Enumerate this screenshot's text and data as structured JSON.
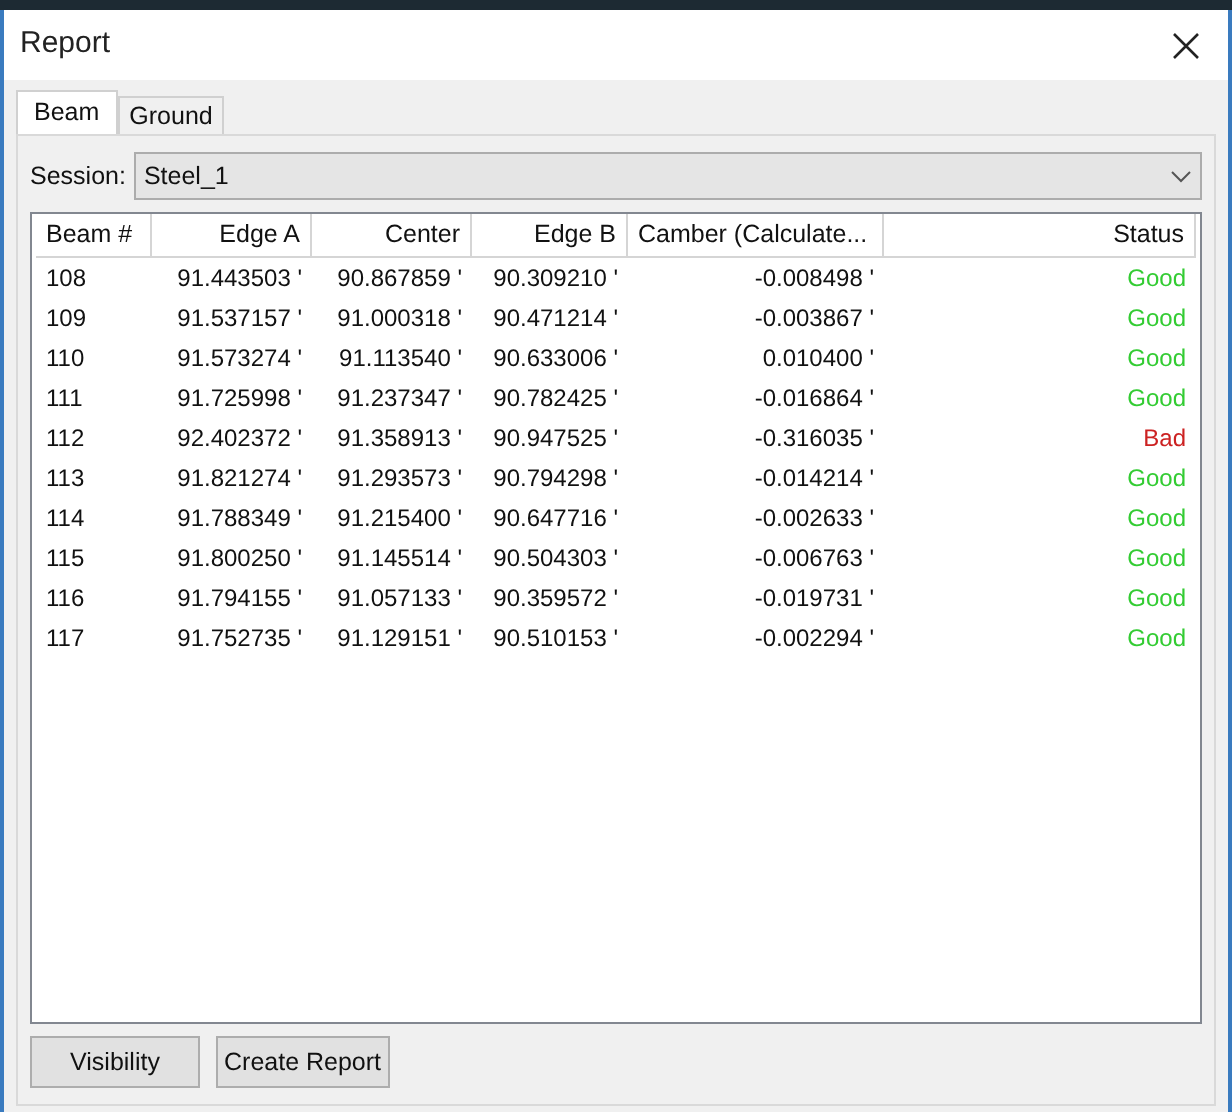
{
  "window": {
    "title": "Report"
  },
  "tabs": [
    {
      "label": "Beam",
      "selected": true
    },
    {
      "label": "Ground",
      "selected": false
    }
  ],
  "session": {
    "label": "Session:",
    "value": "Steel_1"
  },
  "table": {
    "columns": [
      "Beam #",
      "Edge A",
      "Center",
      "Edge B",
      "Camber (Calculate...",
      "Status"
    ],
    "rows": [
      {
        "cells": [
          "108",
          "91.443503 '",
          "90.867859 '",
          "90.309210 '",
          "-0.008498 '"
        ],
        "status": "Good",
        "color": "#33cc33"
      },
      {
        "cells": [
          "109",
          "91.537157 '",
          "91.000318 '",
          "90.471214 '",
          "-0.003867 '"
        ],
        "status": "Good",
        "color": "#33cc33"
      },
      {
        "cells": [
          "110",
          "91.573274 '",
          "91.113540 '",
          "90.633006 '",
          "0.010400 '"
        ],
        "status": "Good",
        "color": "#33cc33"
      },
      {
        "cells": [
          "111",
          "91.725998 '",
          "91.237347 '",
          "90.782425 '",
          "-0.016864 '"
        ],
        "status": "Good",
        "color": "#33cc33"
      },
      {
        "cells": [
          "112",
          "92.402372 '",
          "91.358913 '",
          "90.947525 '",
          "-0.316035 '"
        ],
        "status": "Bad",
        "color": "#cc2222"
      },
      {
        "cells": [
          "113",
          "91.821274 '",
          "91.293573 '",
          "90.794298 '",
          "-0.014214 '"
        ],
        "status": "Good",
        "color": "#33cc33"
      },
      {
        "cells": [
          "114",
          "91.788349 '",
          "91.215400 '",
          "90.647716 '",
          "-0.002633 '"
        ],
        "status": "Good",
        "color": "#33cc33"
      },
      {
        "cells": [
          "115",
          "91.800250 '",
          "91.145514 '",
          "90.504303 '",
          "-0.006763 '"
        ],
        "status": "Good",
        "color": "#33cc33"
      },
      {
        "cells": [
          "116",
          "91.794155 '",
          "91.057133 '",
          "90.359572 '",
          "-0.019731 '"
        ],
        "status": "Good",
        "color": "#33cc33"
      },
      {
        "cells": [
          "117",
          "91.752735 '",
          "91.129151 '",
          "90.510153 '",
          "-0.002294 '"
        ],
        "status": "Good",
        "color": "#33cc33"
      }
    ]
  },
  "buttons": [
    "Visibility",
    "Create Report"
  ]
}
